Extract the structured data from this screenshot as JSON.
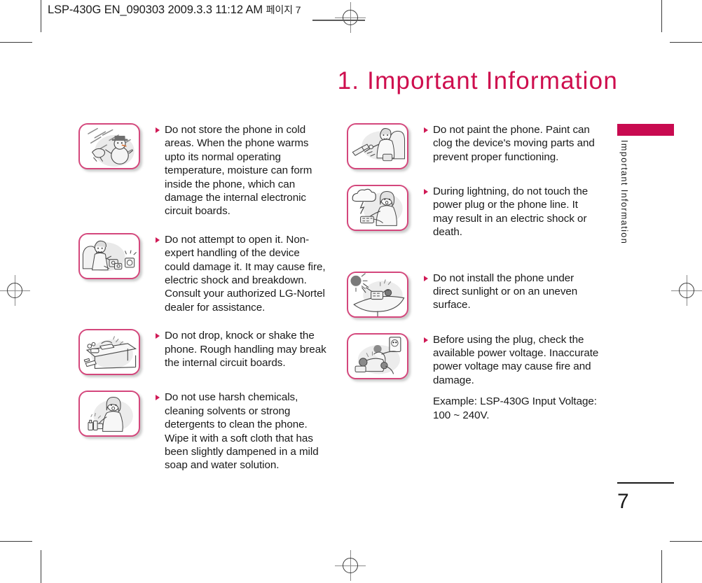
{
  "header": {
    "slug_main": "LSP-430G EN_090303  2009.3.3 11:12 AM",
    "slug_korean": "페이지 7"
  },
  "page_title": "1. Important Information",
  "colors": {
    "accent": "#CE0E4E",
    "sidebar_tab": "#C80A50",
    "bullet_marker": "#D01A56",
    "illustration_border": "#D4477C",
    "body_text": "#1a1a1a"
  },
  "sidebar": {
    "tab_label": "Important Information"
  },
  "folio": {
    "page_number": "7"
  },
  "left_column": [
    {
      "illustration": "snowman-cold-weather-icon",
      "bullets": [
        "Do not store the phone in cold areas. When the phone warms upto its normal operating temperature, moisture can form inside the phone, which can damage the internal electronic circuit boards."
      ]
    },
    {
      "illustration": "person-disassembling-device-icon",
      "bullets": [
        "Do not attempt to open it. Non-expert handling of the device could damage it. It may cause fire, electric shock and breakdown. Consult your authorized LG-Nortel dealer for assistance."
      ]
    },
    {
      "illustration": "phone-falling-off-desk-icon",
      "bullets": [
        "Do not drop, knock or shake the phone. Rough handling may break the internal circuit boards."
      ]
    },
    {
      "illustration": "woman-cleaning-with-chemicals-icon",
      "bullets": [
        "Do not use harsh chemicals, cleaning solvents or strong detergents to clean the phone. Wipe it with a soft cloth that has been slightly dampened in a mild soap and water solution."
      ]
    }
  ],
  "right_column": [
    {
      "illustration": "person-painting-phone-icon",
      "bullets": [
        "Do not paint the phone. Paint can clog the device's moving parts and prevent proper functioning."
      ]
    },
    {
      "illustration": "lightning-storm-phone-icon",
      "bullets": [
        "During lightning, do not touch the power plug or the phone line. It may result in an electric shock or death."
      ]
    },
    {
      "illustration": "sun-uneven-surface-icon",
      "bullets": [
        "Do not install the phone under direct sunlight or on an uneven surface."
      ]
    },
    {
      "illustration": "power-plug-outlet-icon",
      "bullets": [
        "Before using the plug, check the available power voltage. Inaccurate power voltage may cause fire and damage.",
        "Example: LSP-430G Input Voltage: 100 ~ 240V."
      ]
    }
  ]
}
